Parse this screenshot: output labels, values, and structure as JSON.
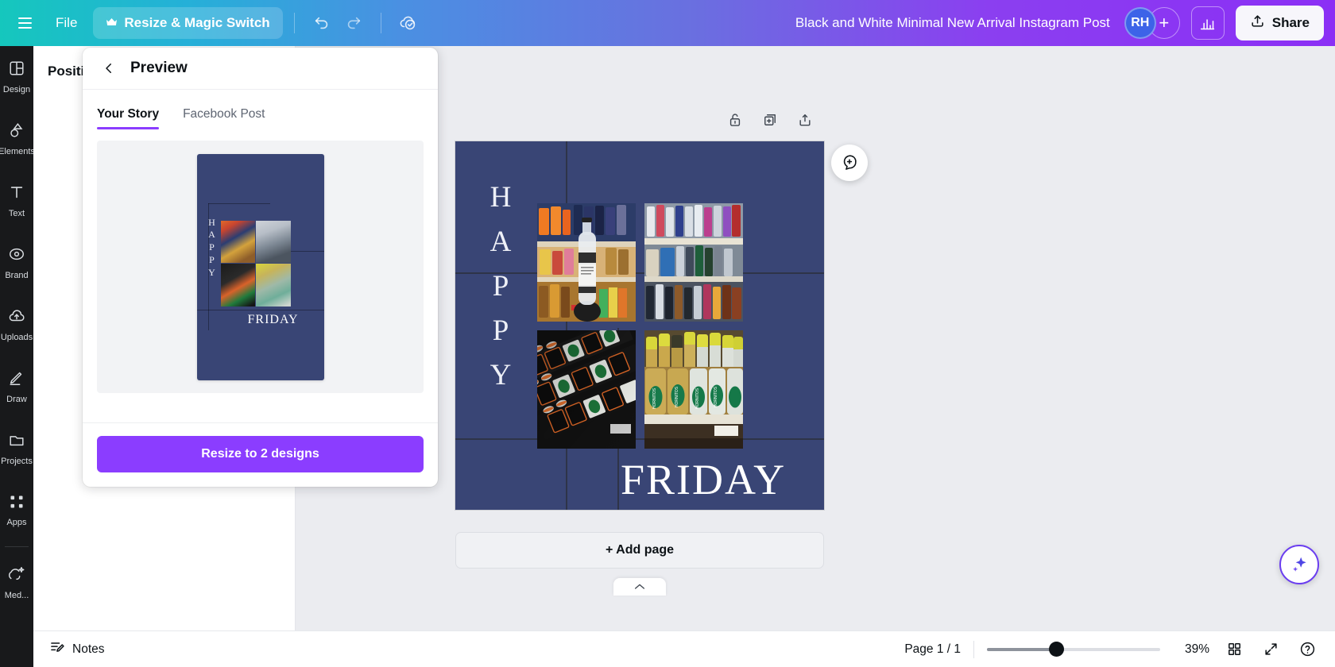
{
  "topbar": {
    "menu_icon": "hamburger-icon",
    "file_label": "File",
    "resize_label": "Resize & Magic Switch",
    "resize_crown_icon": "crown-icon",
    "undo_icon": "undo-icon",
    "redo_icon": "redo-icon",
    "cloud_saved_icon": "cloud-check-icon",
    "doc_title": "Black and White Minimal New Arrival Instagram Post",
    "avatar_initials": "RH",
    "add_collaborator_icon": "plus-icon",
    "insights_icon": "bar-chart-icon",
    "share_label": "Share",
    "share_icon": "share-upload-icon",
    "accent_purple": "#8b3dff",
    "gradient_from": "#15c7bd",
    "gradient_to": "#8b2ff5"
  },
  "rail": {
    "items": [
      {
        "label": "Design",
        "icon": "design-layout-icon"
      },
      {
        "label": "Elements",
        "icon": "shapes-elements-icon"
      },
      {
        "label": "Text",
        "icon": "text-t-icon"
      },
      {
        "label": "Brand",
        "icon": "brand-stamp-icon"
      },
      {
        "label": "Uploads",
        "icon": "uploads-cloud-icon"
      },
      {
        "label": "Draw",
        "icon": "draw-pen-icon"
      },
      {
        "label": "Projects",
        "icon": "projects-folder-icon"
      },
      {
        "label": "Apps",
        "icon": "apps-grid-icon"
      },
      {
        "label": "Med...",
        "icon": "magic-media-icon"
      }
    ]
  },
  "position_panel": {
    "title": "Positi"
  },
  "preview_panel": {
    "back_icon": "chevron-left-icon",
    "title": "Preview",
    "tabs": [
      {
        "label": "Your Story",
        "active": true
      },
      {
        "label": "Facebook Post",
        "active": false
      }
    ],
    "thumbnail": {
      "happy_letters": [
        "H",
        "A",
        "P",
        "P",
        "Y"
      ],
      "friday_text": "FRIDAY",
      "background_color": "#394575"
    },
    "cta_label": "Resize to 2 designs",
    "cta_color": "#8b3dff"
  },
  "object_toolbar": {
    "lock_icon": "lock-open-icon",
    "duplicate_icon": "duplicate-page-icon",
    "export_icon": "export-page-icon"
  },
  "canvas": {
    "background_color": "#394575",
    "happy_letters": [
      "H",
      "A",
      "P",
      "P",
      "Y"
    ],
    "friday_text": "FRIDAY",
    "photos": [
      {
        "name": "liquor-shelf-bottle-in-hand"
      },
      {
        "name": "vodka-shelf-rows"
      },
      {
        "name": "jagermeister-bottles-display"
      },
      {
        "name": "hornitos-tequila-shelf"
      }
    ],
    "comment_icon": "comment-add-icon",
    "add_page_label": "+ Add page",
    "collapse_icon": "chevron-up-icon",
    "magic_icon": "magic-sparkle-icon"
  },
  "bottombar": {
    "notes_label": "Notes",
    "notes_icon": "notes-pencil-icon",
    "page_count": "Page 1 / 1",
    "zoom_percent": "39%",
    "zoom_value": 39,
    "grid_view_icon": "grid-view-icon",
    "fullscreen_icon": "fullscreen-expand-icon",
    "help_icon": "help-question-icon"
  }
}
